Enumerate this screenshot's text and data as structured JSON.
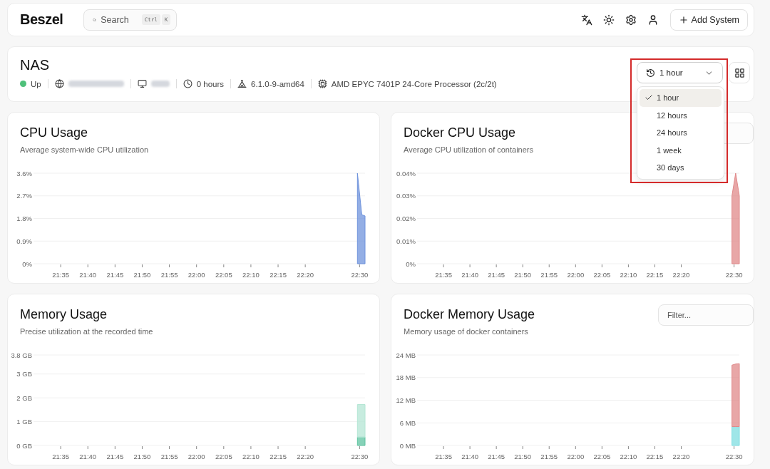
{
  "header": {
    "logo": "Beszel",
    "search": {
      "placeholder": "Search",
      "keys": [
        "Ctrl",
        "K"
      ]
    },
    "add_button": "Add System"
  },
  "system": {
    "name": "NAS",
    "status": {
      "label": "Up",
      "online": true
    },
    "info": [
      {
        "kind": "hidden"
      },
      {
        "kind": "hidden"
      },
      {
        "kind": "text",
        "text": "0 hours"
      },
      {
        "kind": "text",
        "text": "6.1.0-9-amd64"
      },
      {
        "kind": "text",
        "text": "AMD EPYC 7401P 24-Core Processor (2c/2t)"
      }
    ],
    "time_range": {
      "value": "1 hour",
      "expanded": true,
      "highlighted": true,
      "options": [
        {
          "label": "1 hour",
          "selected": true
        },
        {
          "label": "12 hours",
          "selected": false
        },
        {
          "label": "24 hours",
          "selected": false
        },
        {
          "label": "1 week",
          "selected": false
        },
        {
          "label": "30 days",
          "selected": false
        }
      ]
    }
  },
  "charts": [
    {
      "title": "CPU Usage",
      "subtitle": "Average system-wide CPU utilization",
      "chart_data": {
        "type": "area",
        "grid": true,
        "x": [
          1349.6,
          1350.4,
          1351
        ],
        "xlim": [
          1290,
          1351
        ],
        "ylim": [
          0,
          3.6
        ],
        "series": [
          {
            "color": "#6f93dc",
            "values": [
              3.6,
              1.95,
              1.9
            ]
          }
        ],
        "xticks": [
          {
            "value": 1295,
            "label": "21:35"
          },
          {
            "value": 1300,
            "label": "21:40"
          },
          {
            "value": 1305,
            "label": "21:45"
          },
          {
            "value": 1310,
            "label": "21:50"
          },
          {
            "value": 1315,
            "label": "21:55"
          },
          {
            "value": 1320,
            "label": "22:00"
          },
          {
            "value": 1325,
            "label": "22:05"
          },
          {
            "value": 1330,
            "label": "22:10"
          },
          {
            "value": 1335,
            "label": "22:15"
          },
          {
            "value": 1340,
            "label": "22:20"
          },
          {
            "value": 1350,
            "label": "22:30"
          }
        ],
        "yticks": [
          {
            "value": 0,
            "label": "0%"
          },
          {
            "value": 0.9,
            "label": "0.9%"
          },
          {
            "value": 1.8,
            "label": "1.8%"
          },
          {
            "value": 2.7,
            "label": "2.7%"
          },
          {
            "value": 3.6,
            "label": "3.6%"
          }
        ]
      }
    },
    {
      "title": "Docker CPU Usage",
      "subtitle": "Average CPU utilization of containers",
      "filter": true,
      "chart_data": {
        "type": "area",
        "grid": true,
        "x": [
          1349.6,
          1350.3,
          1351
        ],
        "xlim": [
          1290,
          1351
        ],
        "ylim": [
          0,
          0.04
        ],
        "series": [
          {
            "color": "#e0898a",
            "values": [
              0.03,
              0.04,
              0.03
            ]
          }
        ],
        "xticks": [
          {
            "value": 1295,
            "label": "21:35"
          },
          {
            "value": 1300,
            "label": "21:40"
          },
          {
            "value": 1305,
            "label": "21:45"
          },
          {
            "value": 1310,
            "label": "21:50"
          },
          {
            "value": 1315,
            "label": "21:55"
          },
          {
            "value": 1320,
            "label": "22:00"
          },
          {
            "value": 1325,
            "label": "22:05"
          },
          {
            "value": 1330,
            "label": "22:10"
          },
          {
            "value": 1335,
            "label": "22:15"
          },
          {
            "value": 1340,
            "label": "22:20"
          },
          {
            "value": 1350,
            "label": "22:30"
          }
        ],
        "yticks": [
          {
            "value": 0,
            "label": "0%"
          },
          {
            "value": 0.01,
            "label": "0.01%"
          },
          {
            "value": 0.02,
            "label": "0.02%"
          },
          {
            "value": 0.03,
            "label": "0.03%"
          },
          {
            "value": 0.04,
            "label": "0.04%"
          }
        ]
      }
    },
    {
      "title": "Memory Usage",
      "subtitle": "Precise utilization at the recorded time",
      "chart_data": {
        "type": "area",
        "grid": true,
        "stacked": true,
        "x": [
          1349.6,
          1351
        ],
        "xlim": [
          1290,
          1351
        ],
        "ylim": [
          0,
          3.8
        ],
        "series": [
          {
            "color": "#5ec3a0",
            "values": [
              0.35,
              0.35
            ]
          },
          {
            "color": "#b4e6d4",
            "values": [
              1.37,
              1.37
            ]
          }
        ],
        "xticks": [
          {
            "value": 1295,
            "label": "21:35"
          },
          {
            "value": 1300,
            "label": "21:40"
          },
          {
            "value": 1305,
            "label": "21:45"
          },
          {
            "value": 1310,
            "label": "21:50"
          },
          {
            "value": 1315,
            "label": "21:55"
          },
          {
            "value": 1320,
            "label": "22:00"
          },
          {
            "value": 1325,
            "label": "22:05"
          },
          {
            "value": 1330,
            "label": "22:10"
          },
          {
            "value": 1335,
            "label": "22:15"
          },
          {
            "value": 1340,
            "label": "22:20"
          },
          {
            "value": 1350,
            "label": "22:30"
          }
        ],
        "yticks": [
          {
            "value": 0,
            "label": "0 GB"
          },
          {
            "value": 1,
            "label": "1 GB"
          },
          {
            "value": 2,
            "label": "2 GB"
          },
          {
            "value": 3,
            "label": "3 GB"
          },
          {
            "value": 3.8,
            "label": "3.8 GB"
          }
        ]
      }
    },
    {
      "title": "Docker Memory Usage",
      "subtitle": "Memory usage of docker containers",
      "filter": true,
      "filter_placeholder": "Filter...",
      "chart_data": {
        "type": "area",
        "grid": true,
        "stacked": true,
        "x": [
          1349.6,
          1350.3,
          1351
        ],
        "xlim": [
          1290,
          1351
        ],
        "ylim": [
          0,
          24
        ],
        "series": [
          {
            "color": "#7fdde0",
            "values": [
              5,
              5,
              5
            ]
          },
          {
            "color": "#e0898a",
            "values": [
              16.3,
              16.6,
              16.7
            ]
          }
        ],
        "xticks": [
          {
            "value": 1295,
            "label": "21:35"
          },
          {
            "value": 1300,
            "label": "21:40"
          },
          {
            "value": 1305,
            "label": "21:45"
          },
          {
            "value": 1310,
            "label": "21:50"
          },
          {
            "value": 1315,
            "label": "21:55"
          },
          {
            "value": 1320,
            "label": "22:00"
          },
          {
            "value": 1325,
            "label": "22:05"
          },
          {
            "value": 1330,
            "label": "22:10"
          },
          {
            "value": 1335,
            "label": "22:15"
          },
          {
            "value": 1340,
            "label": "22:20"
          },
          {
            "value": 1350,
            "label": "22:30"
          }
        ],
        "yticks": [
          {
            "value": 0,
            "label": "0 MB"
          },
          {
            "value": 6,
            "label": "6 MB"
          },
          {
            "value": 12,
            "label": "12 MB"
          },
          {
            "value": 18,
            "label": "18 MB"
          },
          {
            "value": 24,
            "label": "24 MB"
          }
        ]
      }
    }
  ]
}
